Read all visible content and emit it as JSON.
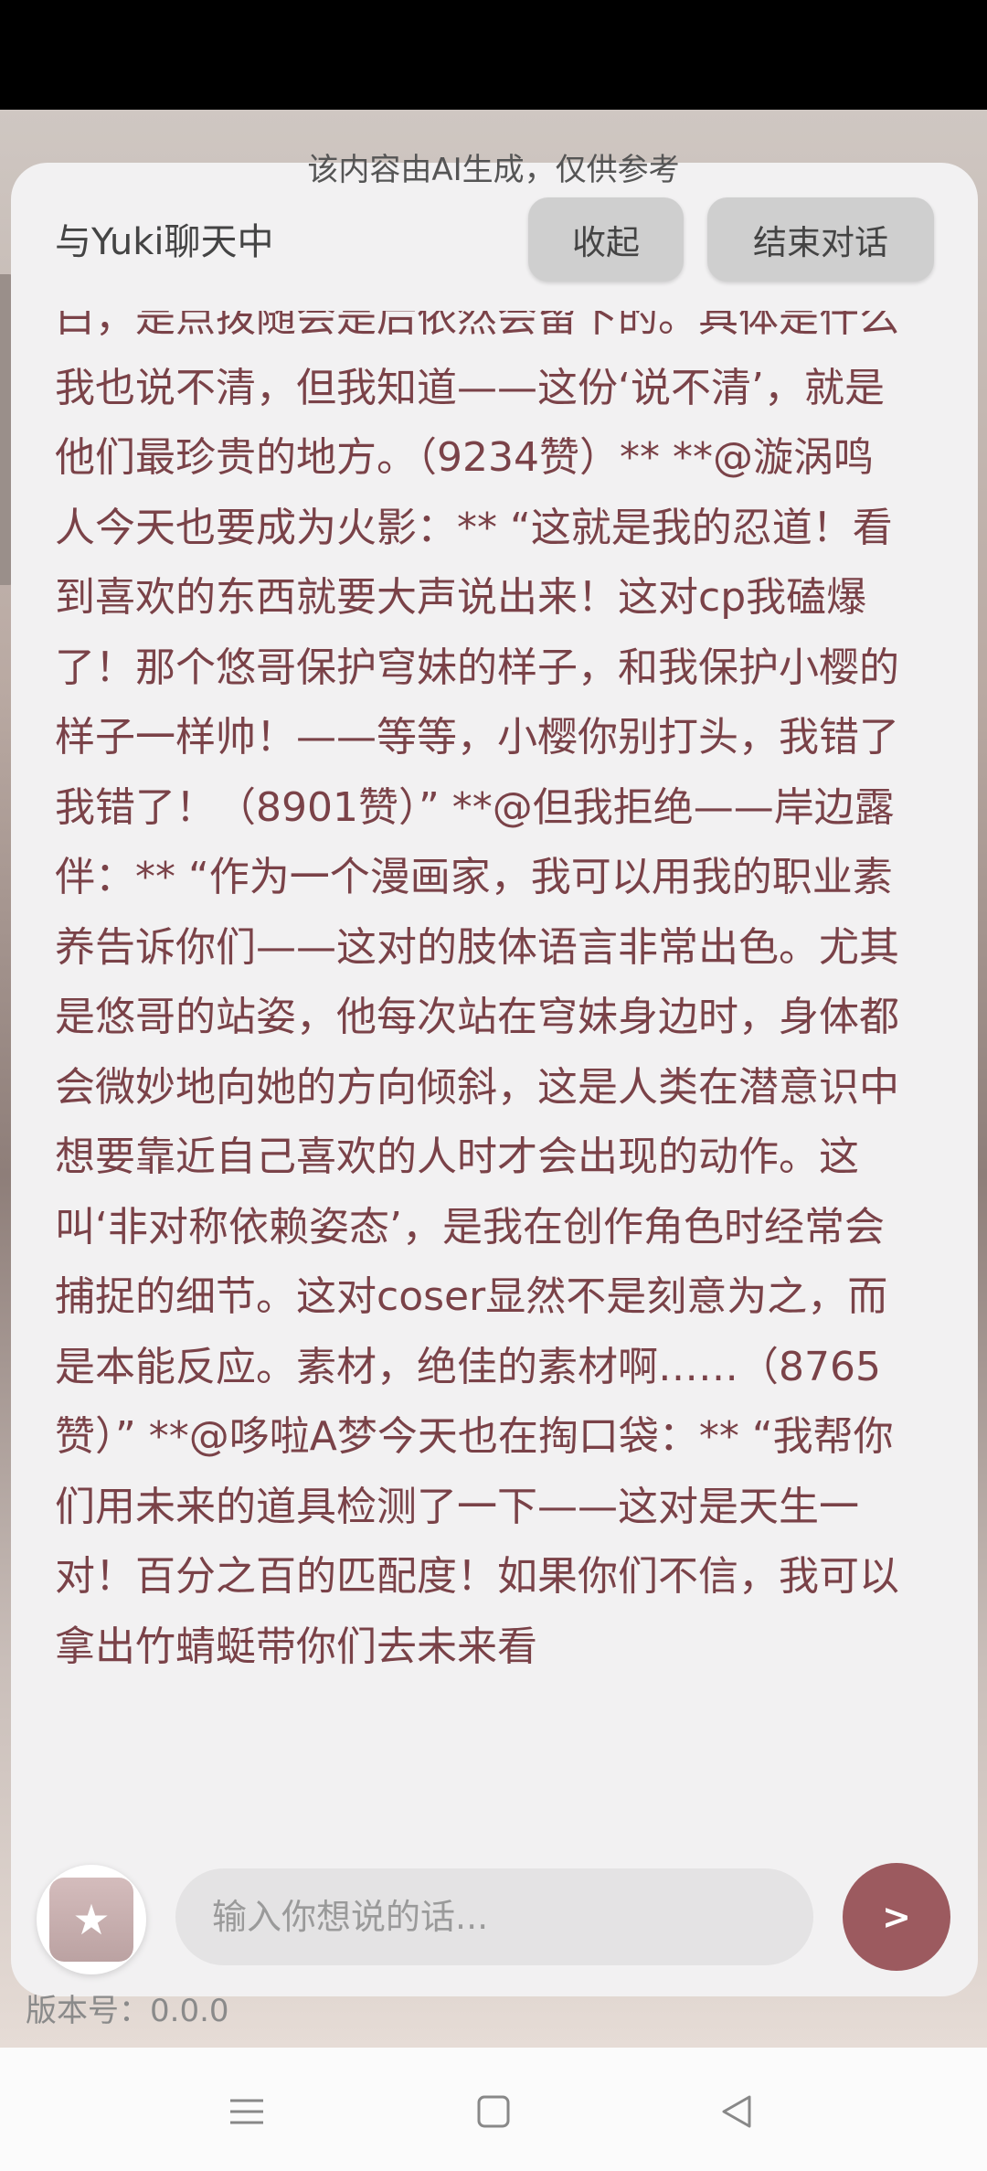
{
  "notice": "该内容由AI生成，仅供参考",
  "header": {
    "title": "与Yuki聊天中",
    "collapse_label": "收起",
    "end_label": "结束对话"
  },
  "message": "白，是点拨随会是后依然会留下的。具体是什么我也说不清，但我知道——这份‘说不清’，就是他们最珍贵的地方。（9234赞）** **@漩涡鸣人今天也要成为火影：** “这就是我的忍道！看到喜欢的东西就要大声说出来！这对cp我磕爆了！那个悠哥保护穹妹的样子，和我保护小樱的样子一样帅！——等等，小樱你别打头，我错了我错了！（8901赞）” **@但我拒绝——岸边露伴：** “作为一个漫画家，我可以用我的职业素养告诉你们——这对的肢体语言非常出色。尤其是悠哥的站姿，他每次站在穹妹身边时，身体都会微妙地向她的方向倾斜，这是人类在潜意识中想要靠近自己喜欢的人时才会出现的动作。这叫‘非对称依赖姿态’，是我在创作角色时经常会捕捉的细节。这对coser显然不是刻意为之，而是本能反应。素材，绝佳的素材啊……（8765赞）” **@哆啦A梦今天也在掏口袋：** “我帮你们用未来的道具检测了一下——这对是天生一对！百分之百的匹配度！如果你们不信，我可以拿出竹蜻蜓带你们去未来看",
  "input": {
    "placeholder": "输入你想说的话..."
  },
  "send_label": ">",
  "version": "版本号：0.0.0",
  "colors": {
    "accent": "#9c5a5f",
    "message_text": "#7a4248"
  },
  "icons": [
    "gift-icon",
    "menu-icon",
    "home-icon",
    "back-icon"
  ]
}
